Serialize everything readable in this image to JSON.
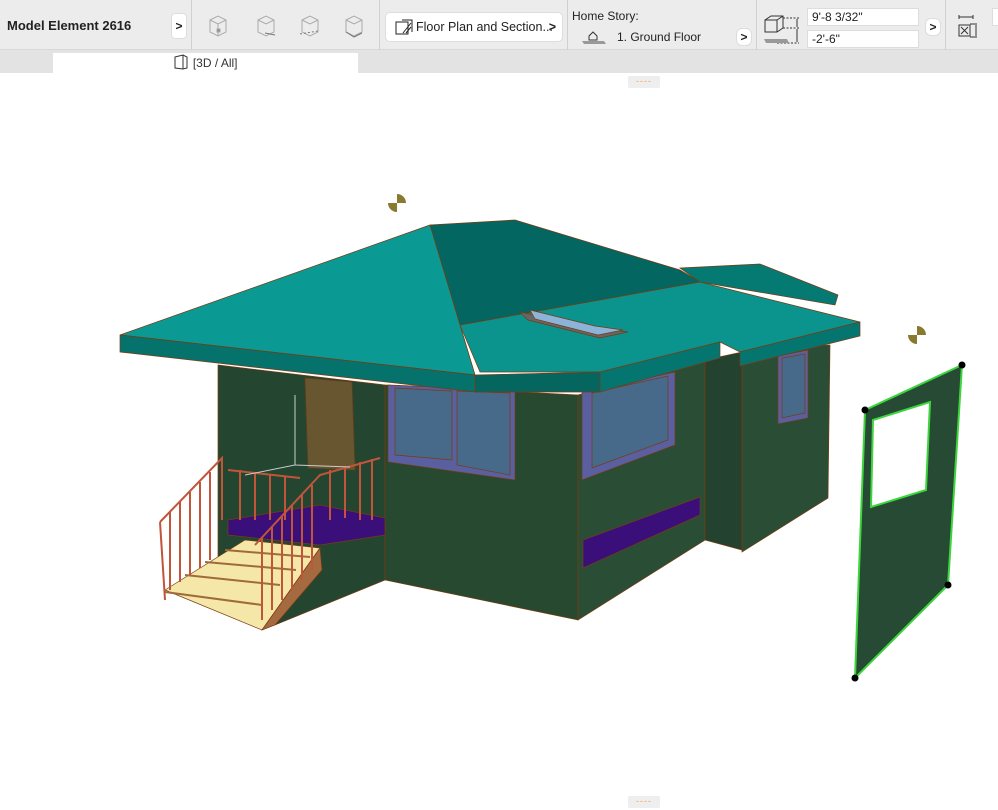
{
  "toolbar": {
    "element_title": "Model Element 2616",
    "view_button_label": "Floor Plan and Section...",
    "home_story_label": "Home Story:",
    "home_story_value": "1. Ground Floor",
    "top_offset": "9'-8 3/32\"",
    "bottom_offset": "-2'-6\"",
    "chevron": ">"
  },
  "tab": {
    "label": "[3D / All]"
  },
  "handles": {
    "top": "----",
    "bottom": "----"
  },
  "colors": {
    "roof": "#0b9a93",
    "wall": "#264a33",
    "selection": "#3cd63c",
    "handle": "#f0a060"
  }
}
